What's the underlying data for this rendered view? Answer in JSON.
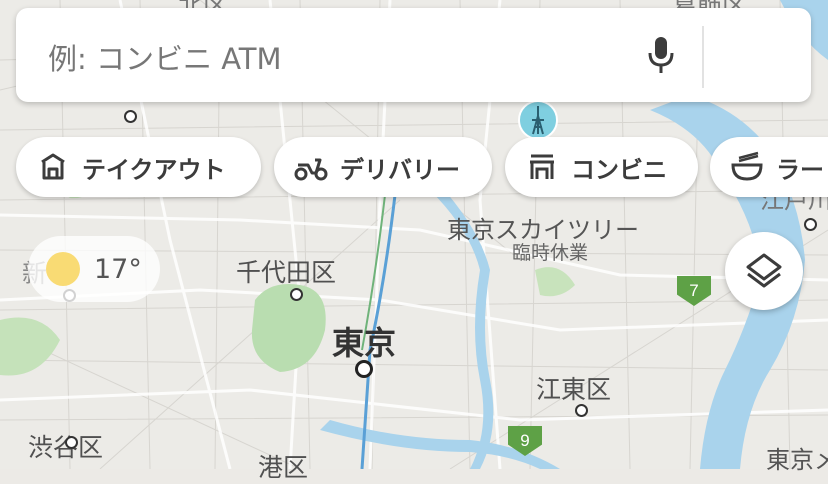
{
  "search": {
    "placeholder": "例: コンビニ ATM"
  },
  "chips": [
    {
      "label": "テイクアウト",
      "icon": "takeout-icon"
    },
    {
      "label": "デリバリー",
      "icon": "delivery-scooter-icon"
    },
    {
      "label": "コンビニ",
      "icon": "convenience-store-icon"
    },
    {
      "label": "ラー",
      "icon": "ramen-bowl-icon"
    }
  ],
  "weather": {
    "temperature": "17°",
    "icon": "sun-icon"
  },
  "map_labels": {
    "skytree": "東京スカイツリー",
    "skytree_status": "臨時休業",
    "chiyoda": "千代田区",
    "tokyo": "東京",
    "koto": "江東区",
    "shibuya": "渋谷区",
    "minato": "港区",
    "shinjuku_partial": "新",
    "katsushika_partial": "葛飾区",
    "edogawa_partial": "江戸川",
    "top_left_partial": "北区",
    "edge_right_partial": "東京メ"
  },
  "route_badges": [
    "7",
    "9"
  ],
  "colors": {
    "water": "#a9d3ec",
    "park": "#bfe0b5",
    "route_badge": "#5ea146"
  }
}
